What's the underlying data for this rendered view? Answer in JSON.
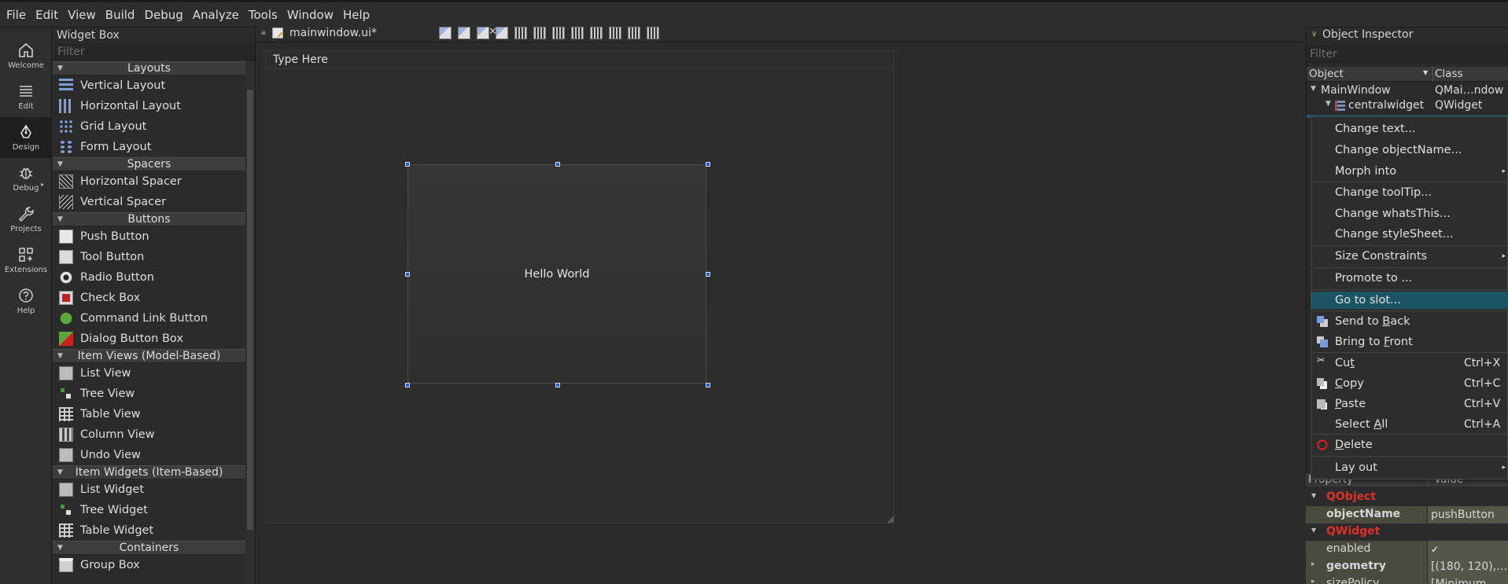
{
  "menubar": [
    "File",
    "Edit",
    "View",
    "Build",
    "Debug",
    "Analyze",
    "Tools",
    "Window",
    "Help"
  ],
  "modes": [
    {
      "label": "Welcome",
      "icon": "home-icon"
    },
    {
      "label": "Edit",
      "icon": "lines-icon"
    },
    {
      "label": "Design",
      "icon": "pen-icon"
    },
    {
      "label": "Debug",
      "icon": "bug-icon"
    },
    {
      "label": "Projects",
      "icon": "wrench-icon"
    },
    {
      "label": "Extensions",
      "icon": "grid-plus-icon"
    },
    {
      "label": "Help",
      "icon": "question-icon"
    }
  ],
  "widget_box": {
    "title": "Widget Box",
    "filter_placeholder": "Filter",
    "groups": [
      {
        "category": "Layouts",
        "items": [
          "Vertical Layout",
          "Horizontal Layout",
          "Grid Layout",
          "Form Layout"
        ]
      },
      {
        "category": "Spacers",
        "items": [
          "Horizontal Spacer",
          "Vertical Spacer"
        ]
      },
      {
        "category": "Buttons",
        "items": [
          "Push Button",
          "Tool Button",
          "Radio Button",
          "Check Box",
          "Command Link Button",
          "Dialog Button Box"
        ]
      },
      {
        "category": "Item Views (Model-Based)",
        "items": [
          "List View",
          "Tree View",
          "Table View",
          "Column View",
          "Undo View"
        ]
      },
      {
        "category": "Item Widgets (Item-Based)",
        "items": [
          "List Widget",
          "Tree Widget",
          "Table Widget"
        ]
      },
      {
        "category": "Containers",
        "items": [
          "Group Box"
        ]
      }
    ]
  },
  "editor": {
    "document": "mainwindow.ui*",
    "form_menu_placeholder": "Type Here",
    "button_text": "Hello World"
  },
  "inspector": {
    "title": "Object Inspector",
    "filter_placeholder": "Filter",
    "col_object": "Object",
    "col_class": "Class",
    "rows": [
      {
        "object": "MainWindow",
        "class": "QMai…ndow"
      },
      {
        "object": "centralwidget",
        "class": "QWidget"
      }
    ]
  },
  "context_menu": {
    "items": [
      {
        "label": "Change text...",
        "shortcut": ""
      },
      {
        "label": "Change objectName...",
        "shortcut": ""
      },
      {
        "label": "Morph into",
        "shortcut": ""
      },
      {
        "label": "Change toolTip...",
        "shortcut": ""
      },
      {
        "label": "Change whatsThis...",
        "shortcut": ""
      },
      {
        "label": "Change styleSheet...",
        "shortcut": ""
      },
      {
        "label": "Size Constraints",
        "shortcut": ""
      },
      {
        "label": "Promote to ...",
        "shortcut": ""
      },
      {
        "label": "Go to slot...",
        "shortcut": ""
      },
      {
        "label": "Send to Back",
        "shortcut": ""
      },
      {
        "label": "Bring to Front",
        "shortcut": ""
      },
      {
        "label": "Cut",
        "shortcut": "Ctrl+X"
      },
      {
        "label": "Copy",
        "shortcut": "Ctrl+C"
      },
      {
        "label": "Paste",
        "shortcut": "Ctrl+V"
      },
      {
        "label": "Select All",
        "shortcut": "Ctrl+A"
      },
      {
        "label": "Delete",
        "shortcut": ""
      },
      {
        "label": "Lay out",
        "shortcut": ""
      }
    ]
  },
  "property_editor": {
    "col_property": "Property",
    "col_value": "Value",
    "rows": [
      {
        "type": "group",
        "name": "QObject"
      },
      {
        "type": "prop",
        "name": "objectName",
        "value": "pushButton",
        "bold": true
      },
      {
        "type": "group",
        "name": "QWidget"
      },
      {
        "type": "prop",
        "name": "enabled",
        "value": "✓",
        "bold": false
      },
      {
        "type": "prop",
        "name": "geometry",
        "value": "[(180, 120),…",
        "bold": true
      },
      {
        "type": "prop",
        "name": "sizePolicy",
        "value": "[Minimum,…",
        "bold": false
      }
    ]
  },
  "colors": {
    "highlight": "#1b5563",
    "property_group": "#e0302a",
    "selection_handle": "#1a5fd1"
  }
}
